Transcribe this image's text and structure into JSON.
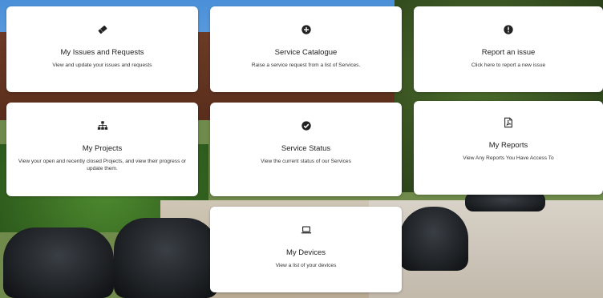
{
  "cards": {
    "issues": {
      "title": "My Issues and Requests",
      "desc": "View and update your issues and requests",
      "icon": "ticket-icon"
    },
    "catalog": {
      "title": "Service Catalogue",
      "desc": "Raise a service request from a list of Services.",
      "icon": "plus-circle-icon"
    },
    "report": {
      "title": "Report an issue",
      "desc": "Click here to report a new issue",
      "icon": "exclamation-circle-icon"
    },
    "projects": {
      "title": "My Projects",
      "desc": "View your open and recently closed Projects, and view their progress or update them.",
      "icon": "sitemap-icon"
    },
    "status": {
      "title": "Service Status",
      "desc": "View the current status of our Services",
      "icon": "check-circle-icon"
    },
    "reports": {
      "title": "My Reports",
      "desc": "View Any Reports You Have Access To",
      "icon": "pdf-file-icon"
    },
    "devices": {
      "title": "My Devices",
      "desc": "View a list of your devices",
      "icon": "laptop-icon"
    }
  },
  "colors": {
    "card_bg": "#ffffff",
    "icon": "#222222",
    "text": "#222222"
  }
}
